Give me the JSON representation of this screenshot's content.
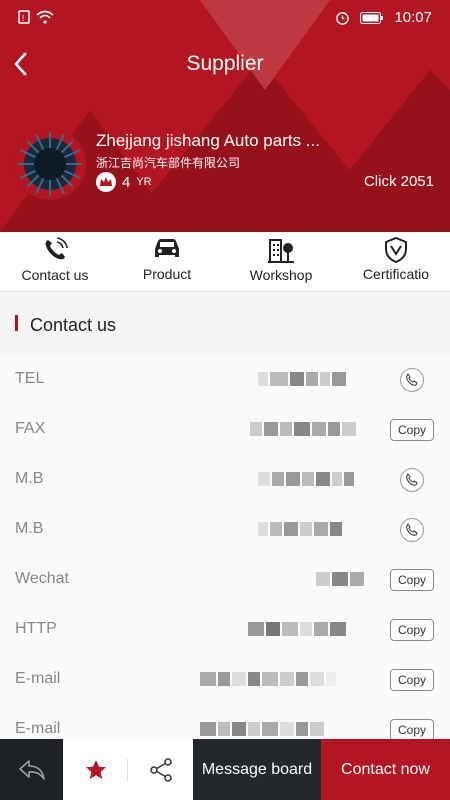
{
  "status": {
    "time": "10:07"
  },
  "header": {
    "title": "Supplier"
  },
  "supplier": {
    "name": "Zhejjang jishang Auto parts ...",
    "name_cn": "浙江吉尚汽车部件有限公司",
    "years_value": "4",
    "years_unit": "YR",
    "clicks": "Click 2051"
  },
  "tabs": [
    {
      "label": "Contact us",
      "icon": "phone-icon"
    },
    {
      "label": "Product",
      "icon": "car-icon"
    },
    {
      "label": "Workshop",
      "icon": "building-icon"
    },
    {
      "label": "Certificatio",
      "icon": "shield-icon"
    }
  ],
  "section": {
    "title": "Contact us"
  },
  "contacts": [
    {
      "label": "TEL",
      "action": "call"
    },
    {
      "label": "FAX",
      "action": "copy",
      "action_label": "Copy"
    },
    {
      "label": "M.B",
      "action": "call"
    },
    {
      "label": "M.B",
      "action": "call"
    },
    {
      "label": "Wechat",
      "action": "copy",
      "action_label": "Copy"
    },
    {
      "label": "HTTP",
      "action": "copy",
      "action_label": "Copy"
    },
    {
      "label": "E-mail",
      "action": "copy",
      "action_label": "Copy"
    },
    {
      "label": "E-mail",
      "action": "copy",
      "action_label": "Copy"
    }
  ],
  "bottom": {
    "message_board": "Message board",
    "contact_now": "Contact now"
  },
  "colors": {
    "brand": "#b31521",
    "dark": "#24272b"
  }
}
